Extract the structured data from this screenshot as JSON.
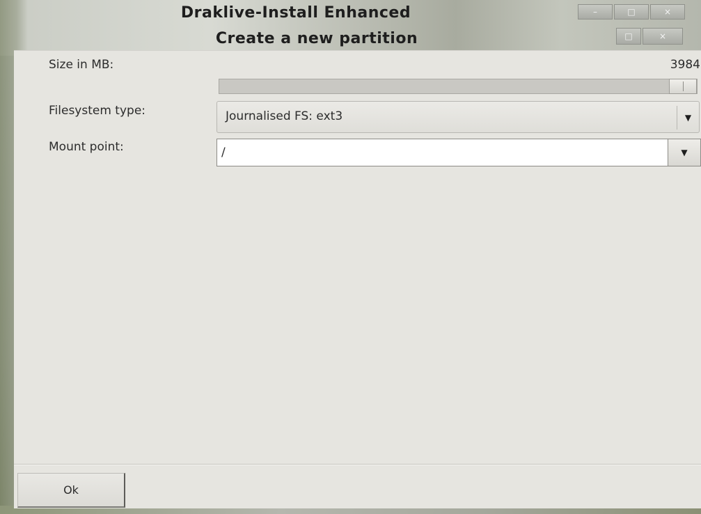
{
  "window": {
    "app_title": "Draklive-Install Enhanced",
    "dialog_title": "Create a new partition"
  },
  "form": {
    "size_label": "Size in MB:",
    "size_value": "3984",
    "size_slider_fraction": 1.0,
    "fs_label": "Filesystem type:",
    "fs_value": "Journalised FS: ext3",
    "mount_label": "Mount point:",
    "mount_value": "/"
  },
  "buttons": {
    "ok_label": "Ok"
  },
  "icons": {
    "dropdown": "chevron-down-icon",
    "minimize": "minimize-icon",
    "maximize": "maximize-icon",
    "close": "close-icon"
  }
}
